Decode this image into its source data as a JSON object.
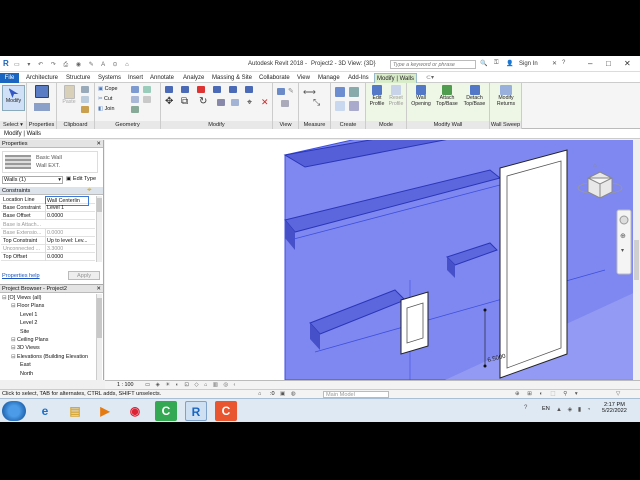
{
  "title": {
    "app": "Autodesk Revit 2018 -",
    "doc": "Project2 - 3D View: {3D}",
    "search_placeholder": "Type a keyword or phrase",
    "sign_in": "Sign In"
  },
  "tabs": [
    "File",
    "Architecture",
    "Structure",
    "Systems",
    "Insert",
    "Annotate",
    "Analyze",
    "Massing & Site",
    "Collaborate",
    "View",
    "Manage",
    "Add-Ins",
    "Modify | Walls"
  ],
  "ribbon": {
    "modify": "Modify",
    "select": "Select",
    "properties": "Properties",
    "paste": "Paste",
    "clipboard": "Clipboard",
    "cope": "Cope",
    "cut": "Cut",
    "join": "Join",
    "geometry": "Geometry",
    "modify_panel": "Modify",
    "view": "View",
    "measure": "Measure",
    "create": "Create",
    "edit_profile": "Edit Profile",
    "reset_profile": "Reset Profile",
    "mode": "Mode",
    "wall_opening": "Wall Opening",
    "attach": "Attach Top/Base",
    "detach": "Detach Top/Base",
    "modify_wall": "Modify Wall",
    "modify_returns": "Modify Returns",
    "wall_sweep": "Wall Sweep"
  },
  "context_label": "Modify | Walls",
  "properties": {
    "header": "Properties",
    "type_family": "Basic Wall",
    "type_name": "Wall EXT.",
    "selector": "Walls (1)",
    "edit_type": "Edit Type",
    "section": "Constraints",
    "rows": [
      {
        "k": "Location Line",
        "v": "Wall Centerlin"
      },
      {
        "k": "Base Constraint",
        "v": "Level 1"
      },
      {
        "k": "Base Offset",
        "v": "0.0000"
      },
      {
        "k": "Base is Attach...",
        "v": ""
      },
      {
        "k": "Base Extensio...",
        "v": "0.0000"
      },
      {
        "k": "Top Constraint",
        "v": "Up to level: Lev..."
      },
      {
        "k": "Unconnected ...",
        "v": "3.3000"
      },
      {
        "k": "Top Offset",
        "v": "0.0000"
      }
    ],
    "help": "Properties help",
    "apply": "Apply"
  },
  "browser": {
    "header": "Project Browser - Project2",
    "nodes": [
      {
        "label": "[O] Views (all)",
        "indent": 0
      },
      {
        "label": "Floor Plans",
        "indent": 1
      },
      {
        "label": "Level 1",
        "indent": 2
      },
      {
        "label": "Level 2",
        "indent": 2
      },
      {
        "label": "Site",
        "indent": 2
      },
      {
        "label": "Ceiling Plans",
        "indent": 1
      },
      {
        "label": "3D Views",
        "indent": 1
      },
      {
        "label": "Elevations (Building Elevation",
        "indent": 1
      },
      {
        "label": "East",
        "indent": 2
      },
      {
        "label": "North",
        "indent": 2
      }
    ]
  },
  "viewport": {
    "dimension": "6.5000",
    "scale": "1 : 100"
  },
  "statusbar": {
    "message": "Click to select, TAB for alternates, CTRL adds, SHIFT unselects.",
    "coord": ":0",
    "model": "Main Model"
  },
  "taskbar": {
    "lang": "EN",
    "time": "2:17 PM",
    "date": "5/22/2022"
  },
  "colors": {
    "wall": "#7f88f0",
    "wall_dark": "#5560d8",
    "selection": "#3d4fe0",
    "file_tab": "#1a65c0",
    "context_tab": "#d9ecc9"
  }
}
